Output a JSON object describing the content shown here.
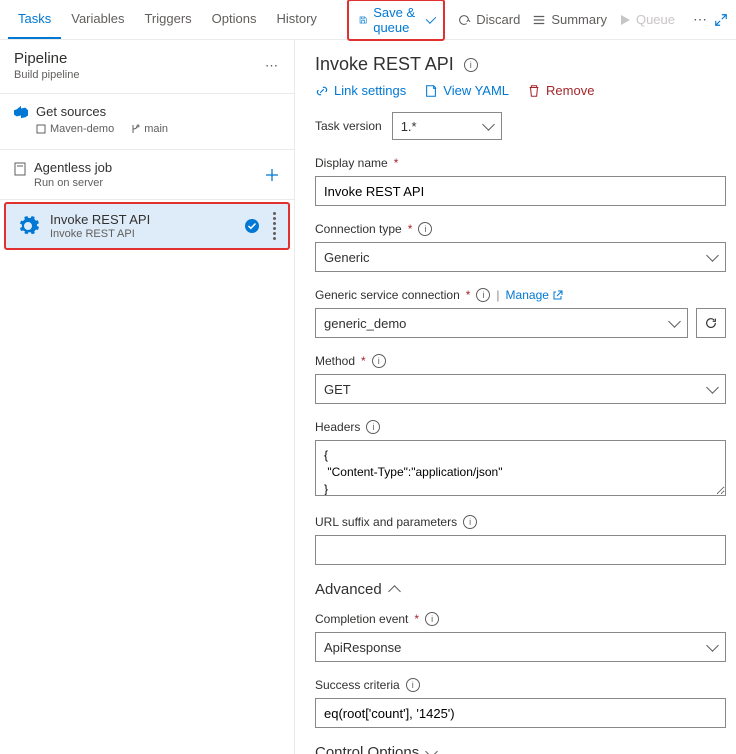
{
  "nav": {
    "tabs": [
      "Tasks",
      "Variables",
      "Triggers",
      "Options",
      "History"
    ]
  },
  "toolbar": {
    "save_queue": "Save & queue",
    "discard": "Discard",
    "summary": "Summary",
    "queue": "Queue"
  },
  "pipeline": {
    "title": "Pipeline",
    "subtitle": "Build pipeline"
  },
  "get_sources": {
    "title": "Get sources",
    "repo": "Maven-demo",
    "branch": "main"
  },
  "agentless": {
    "title": "Agentless job",
    "subtitle": "Run on server"
  },
  "task": {
    "title": "Invoke REST API",
    "subtitle": "Invoke REST API"
  },
  "rp": {
    "title": "Invoke REST API",
    "link_settings": "Link settings",
    "view_yaml": "View YAML",
    "remove": "Remove"
  },
  "fields": {
    "task_version_label": "Task version",
    "task_version_value": "1.*",
    "display_name_label": "Display name",
    "display_name_value": "Invoke REST API",
    "connection_type_label": "Connection type",
    "connection_type_value": "Generic",
    "service_conn_label": "Generic service connection",
    "service_conn_value": "generic_demo",
    "manage": "Manage",
    "method_label": "Method",
    "method_value": "GET",
    "headers_label": "Headers",
    "headers_value": "{\n \"Content-Type\":\"application/json\"\n}",
    "url_suffix_label": "URL suffix and parameters",
    "url_suffix_value": "",
    "advanced": "Advanced",
    "completion_label": "Completion event",
    "completion_value": "ApiResponse",
    "success_label": "Success criteria",
    "success_value": "eq(root['count'], '1425')",
    "control_options": "Control Options"
  }
}
